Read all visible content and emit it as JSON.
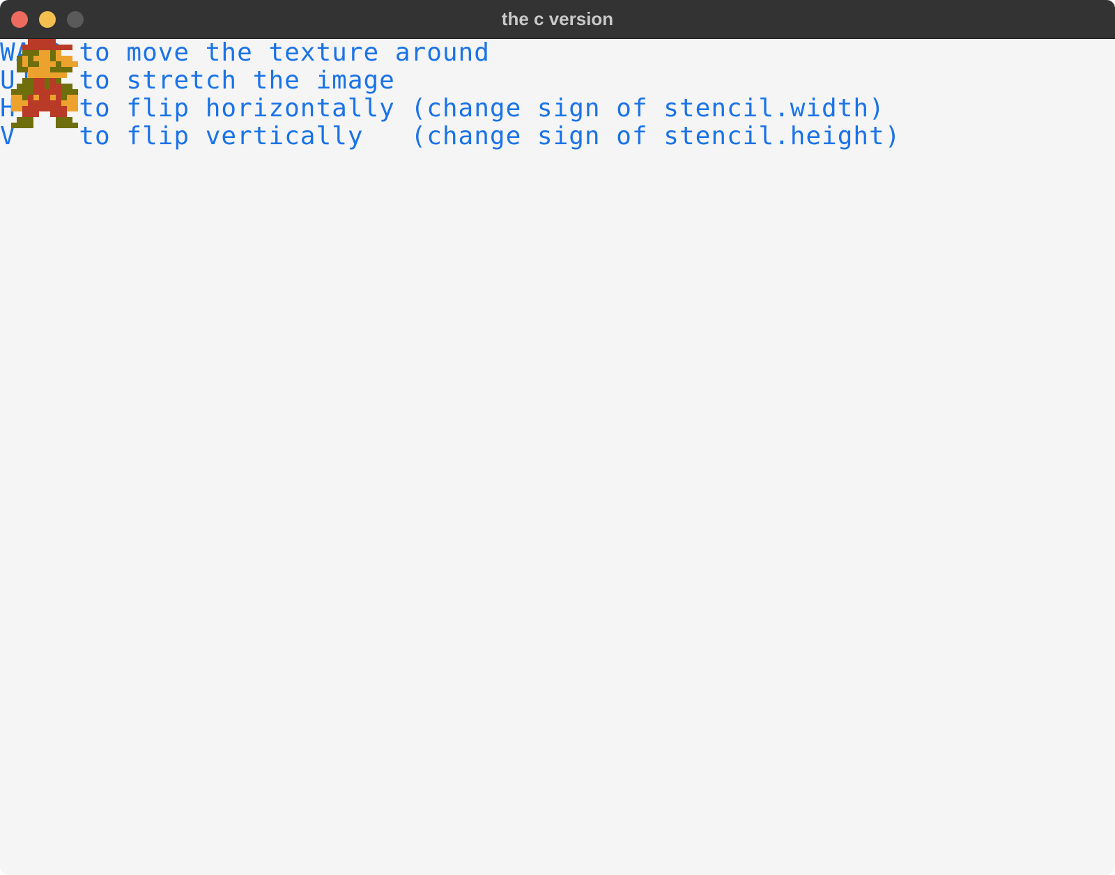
{
  "window": {
    "title": "the c version"
  },
  "instructions": [
    "WASD to move the texture around",
    "UJIK to stretch the image",
    "H    to flip horizontally (change sign of stencil.width)",
    "V    to flip vertically   (change sign of stencil.height)"
  ],
  "sprite": {
    "icon": "mario-sprite-icon",
    "palette": {
      "red": "#b93a26",
      "skin": "#eda22d",
      "olive": "#6e6e0c"
    }
  },
  "colors": {
    "text": "#1a73e8",
    "background": "#f5f5f5",
    "titlebar": "#333333"
  }
}
